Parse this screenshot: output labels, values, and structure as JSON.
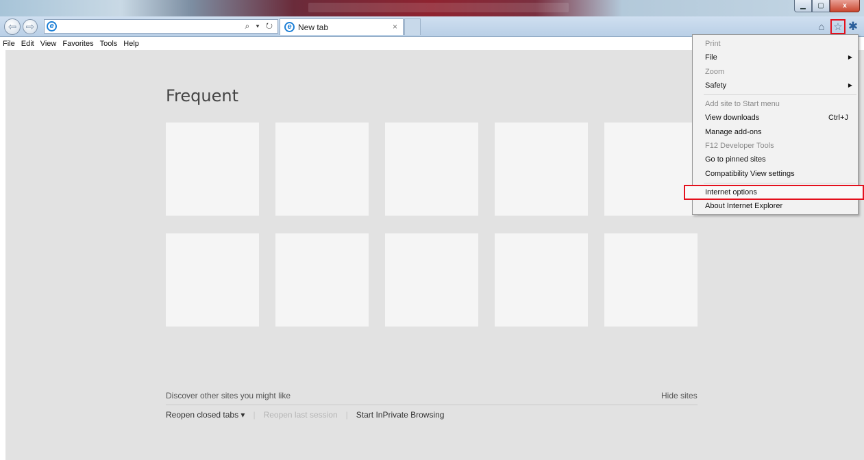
{
  "window": {
    "minimize_icon": "minimize-icon",
    "maximize_icon": "maximize-icon",
    "close_label": "x"
  },
  "nav": {
    "back_icon": "back-arrow-icon",
    "forward_icon": "forward-arrow-icon",
    "address_value": "",
    "address_controls": "⌕ ▾ ↻",
    "tab_title": "New tab",
    "tab_close": "×"
  },
  "menubar": {
    "items": [
      "File",
      "Edit",
      "View",
      "Favorites",
      "Tools",
      "Help"
    ]
  },
  "newtab_page": {
    "title": "Frequent",
    "discover_text": "Discover other sites you might like",
    "hide_sites": "Hide sites",
    "reopen_closed_tabs": "Reopen closed tabs ▾",
    "reopen_last_session": "Reopen last session",
    "start_inprivate": "Start InPrivate Browsing"
  },
  "tools_menu": {
    "items": [
      {
        "label": "Print",
        "disabled": true
      },
      {
        "label": "File",
        "submenu": true
      },
      {
        "label": "Zoom",
        "disabled": true
      },
      {
        "label": "Safety",
        "submenu": true
      },
      {
        "label": "Add site to Start menu",
        "disabled": true
      },
      {
        "label": "View downloads",
        "shortcut": "Ctrl+J"
      },
      {
        "label": "Manage add-ons"
      },
      {
        "label": "F12 Developer Tools",
        "disabled": true
      },
      {
        "label": "Go to pinned sites"
      },
      {
        "label": "Compatibility View settings"
      },
      {
        "label": "Internet options",
        "highlighted": true
      },
      {
        "label": "About Internet Explorer"
      }
    ],
    "submenu_arrow": "▶"
  },
  "colors": {
    "highlight_box": "#e4101d",
    "content_bg": "#e2e2e2",
    "tile_bg": "#f5f5f5"
  }
}
